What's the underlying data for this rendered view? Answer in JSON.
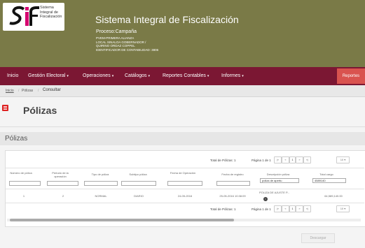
{
  "header": {
    "logo_lines": [
      "Sistema",
      "Integral de",
      "Fiscalización"
    ],
    "system_title": "Sistema Integral de Fiscalización",
    "process": "Proceso:Campaña",
    "details": [
      "PVEM-PRIMERA ALIANZA",
      "LOCAL SINALOA GOBERNADOR /",
      "QUIRINO ORDAZ COPPEL",
      "IDENTIFICADOR DE CONTABILIDAD: 3806"
    ]
  },
  "nav": {
    "items": [
      {
        "label": "Inicio",
        "caret": ""
      },
      {
        "label": "Gestión Electoral",
        "caret": "▾"
      },
      {
        "label": "Operaciones",
        "caret": "▾"
      },
      {
        "label": "Catálogos",
        "caret": "▾"
      },
      {
        "label": "Reportes Contables",
        "caret": "▾"
      },
      {
        "label": "Informes",
        "caret": "▾"
      }
    ],
    "reportes_button": "Reportes"
  },
  "breadcrumb": {
    "inicio": "Inicio",
    "polizas": "Pólizas",
    "current": "Consultar"
  },
  "page": {
    "title": "Pólizas",
    "section_title": "Pólizas"
  },
  "pager": {
    "total": "Total de Pólizas: 1",
    "page_info": "Página 1 de 1",
    "first": "|«",
    "prev": "«",
    "page": "1",
    "next": "»",
    "last": "»|",
    "size": "10 ▾"
  },
  "table": {
    "headers": [
      "Número de póliza",
      "Periodo de la operación",
      "Tipo de póliza",
      "Subtipo póliza",
      "Fecha de Operación",
      "Fecha de registro",
      "Descripción póliza",
      "Total cargo"
    ],
    "filters": [
      "",
      "",
      "",
      "",
      "",
      "",
      "poliza de apertu",
      "4589140"
    ],
    "row": [
      "1",
      "2",
      "NORMAL",
      "DIARIO",
      "24-05-2016",
      "25-05-2016 10:38:09",
      "POLIZA DE AJUSTE P...",
      "64,589,140.00"
    ],
    "info_icon": "i"
  },
  "descargar_label": "Descargar",
  "colors": {
    "header_bg": "#7a7a47",
    "navbar": "#7b1733",
    "reportes": "#d9534f",
    "accent_red": "#dd2222"
  }
}
